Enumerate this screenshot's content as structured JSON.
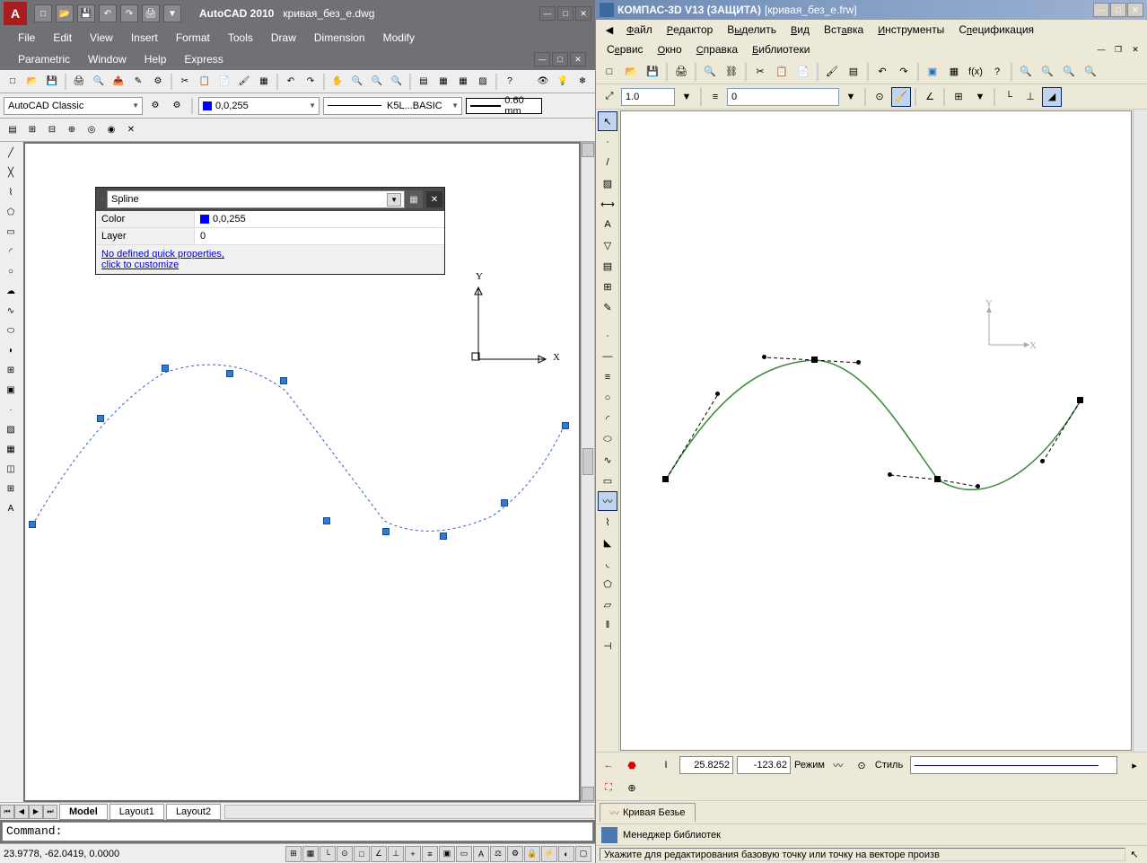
{
  "autocad": {
    "app_name": "AutoCAD 2010",
    "file_name": "кривая_без_e.dwg",
    "menus": [
      "File",
      "Edit",
      "View",
      "Insert",
      "Format",
      "Tools",
      "Draw",
      "Dimension",
      "Modify"
    ],
    "menus2": [
      "Parametric",
      "Window",
      "Help",
      "Express"
    ],
    "workspace": "AutoCAD Classic",
    "color_value": "0,0,255",
    "linetype": "K5L...BASIC",
    "linewidth": "0.60 mm",
    "qprops": {
      "type": "Spline",
      "rows": [
        {
          "label": "Color",
          "value": "0,0,255",
          "swatch": "#0000ff"
        },
        {
          "label": "Layer",
          "value": "0"
        }
      ],
      "link1": "No defined quick properties,",
      "link2": "click to customize"
    },
    "tabs": [
      "Model",
      "Layout1",
      "Layout2"
    ],
    "command_prompt": "Command:",
    "status_coords": "23.9778, -62.0419, 0.0000",
    "axis_x": "X",
    "axis_y": "Y"
  },
  "kompas": {
    "app_name": "КОМПАС-3D V13 (ЗАЩИТА)",
    "file_name": "[кривая_без_e.frw]",
    "menus": [
      "Файл",
      "Редактор",
      "Выделить",
      "Вид",
      "Вставка",
      "Инструменты",
      "Спецификация"
    ],
    "menus2": [
      "Сервис",
      "Окно",
      "Справка",
      "Библиотеки"
    ],
    "scale_value": "1.0",
    "layer_value": "0",
    "coord_x": "25.8252",
    "coord_y": "-123.62",
    "mode_label": "Режим",
    "style_label": "Стиль",
    "tab_name": "Кривая Безье",
    "library_manager": "Менеджер библиотек",
    "status_text": "Укажите для редактирования базовую точку или точку на векторе произв",
    "axis_x": "X",
    "axis_y": "Y"
  }
}
